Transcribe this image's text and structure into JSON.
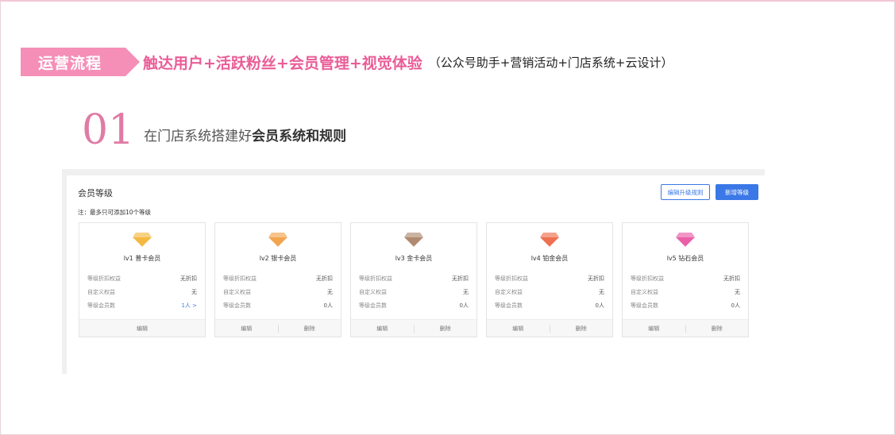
{
  "banner": {
    "tag": "运营流程",
    "headline": "触达用户+活跃粉丝+会员管理+视觉体验",
    "sub": "（公众号助手+营销活动+门店系统+云设计）"
  },
  "step": {
    "number": "01",
    "text_plain": "在门店系统搭建好",
    "text_bold": "会员系统和规则"
  },
  "screen": {
    "title": "会员等级",
    "note": "注：最多只可添加10个等级",
    "edit_rules_button": "编辑升级规则",
    "add_level_button": "新增等级",
    "labels": {
      "discount": "等级折扣权益",
      "custom": "自定义权益",
      "members": "等级会员数"
    },
    "edit_label": "编辑",
    "delete_label": "删除",
    "colors": {
      "primary": "#3b78e7",
      "accent_pink": "#ea5d97"
    },
    "cards": [
      {
        "name": "lv1 普卡会员",
        "discount": "无折扣",
        "custom": "无",
        "members": "1人 >",
        "gem_color": "#f4b942",
        "has_delete": false
      },
      {
        "name": "lv2 银卡会员",
        "discount": "无折扣",
        "custom": "无",
        "members": "0人",
        "gem_color": "#f2a54f",
        "has_delete": true
      },
      {
        "name": "lv3 金卡会员",
        "discount": "无折扣",
        "custom": "无",
        "members": "0人",
        "gem_color": "#b08a70",
        "has_delete": true
      },
      {
        "name": "lv4 铂金会员",
        "discount": "无折扣",
        "custom": "无",
        "members": "0人",
        "gem_color": "#ee7050",
        "has_delete": true
      },
      {
        "name": "lv5 钻石会员",
        "discount": "无折扣",
        "custom": "无",
        "members": "0人",
        "gem_color": "#ea5fa8",
        "has_delete": true
      }
    ]
  }
}
